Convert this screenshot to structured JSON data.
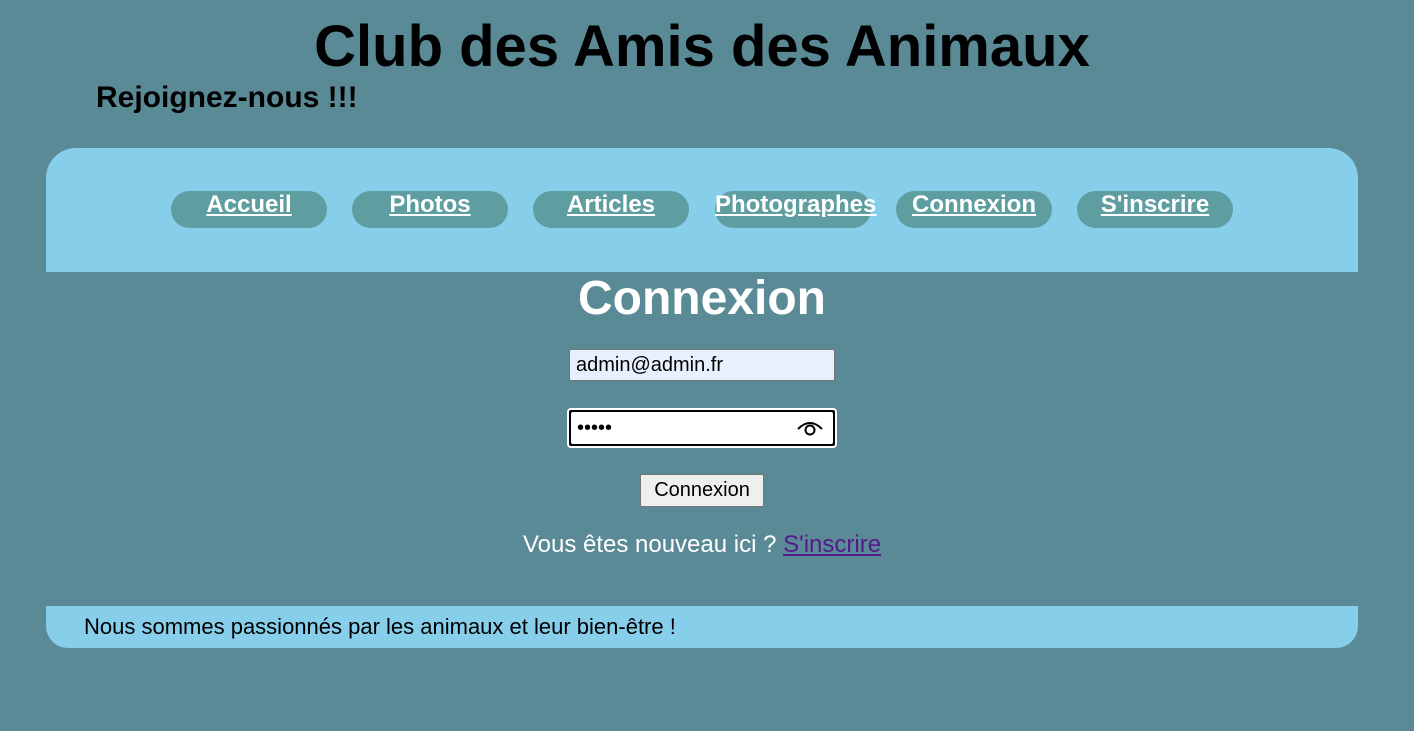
{
  "header": {
    "title": "Club des Amis des Animaux",
    "tagline": "Rejoignez-nous !!!"
  },
  "nav": {
    "items": [
      {
        "label": "Accueil"
      },
      {
        "label": "Photos"
      },
      {
        "label": "Articles"
      },
      {
        "label": "Photographes"
      },
      {
        "label": "Connexion"
      },
      {
        "label": "S'inscrire"
      }
    ]
  },
  "login": {
    "title": "Connexion",
    "email_value": "admin@admin.fr",
    "password_value": "admin",
    "password_icon": "eye-icon",
    "submit_label": "Connexion",
    "signup_prompt": "Vous êtes nouveau ici ? ",
    "signup_link": "S'inscrire"
  },
  "footer": {
    "text": "Nous sommes passionnés par les animaux et leur bien-être !"
  },
  "colors": {
    "background": "#5a8a95",
    "panel": "#87ceeb",
    "nav_pill": "#5f9ea0",
    "link_visited": "#551a8b"
  }
}
